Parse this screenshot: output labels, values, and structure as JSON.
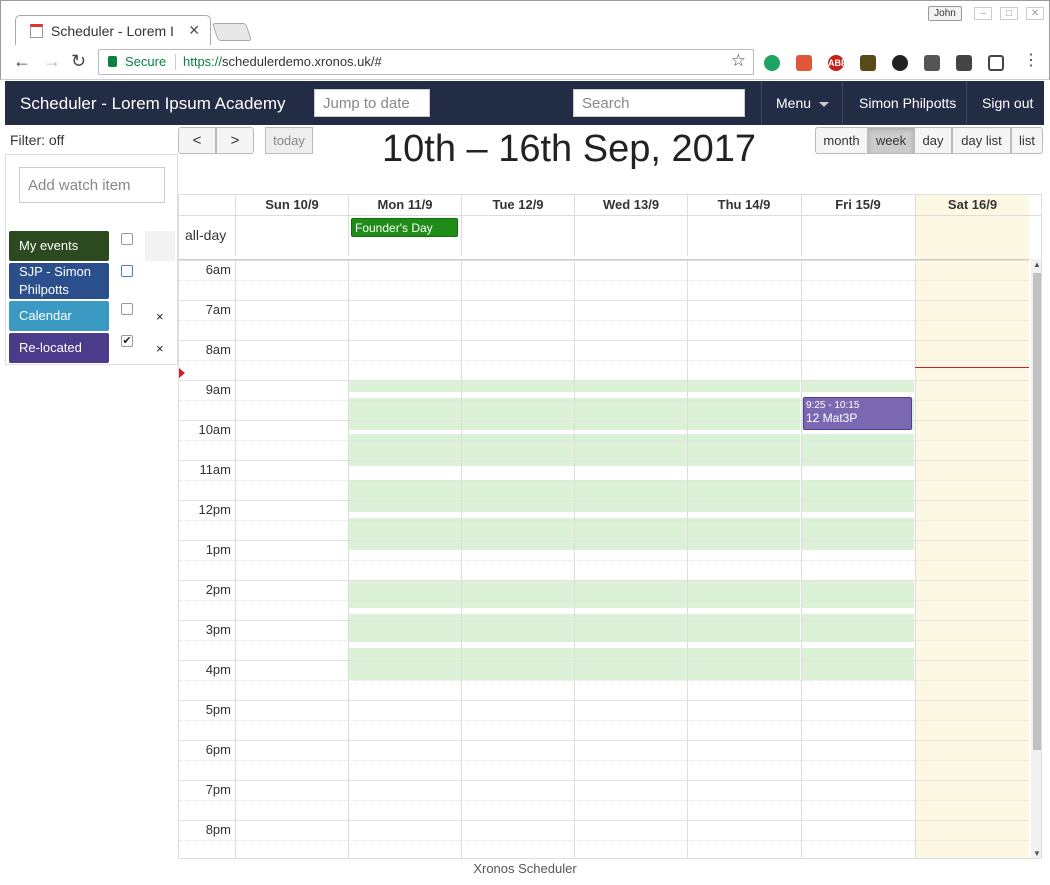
{
  "browser": {
    "tab_title": "Scheduler - Lorem I",
    "user": "John",
    "secure_label": "Secure",
    "url_https": "https://",
    "url_rest": "schedulerdemo.xronos.uk/#",
    "url": "https://schedulerdemo.xronos.uk/#"
  },
  "app": {
    "brand": "Scheduler - Lorem Ipsum Academy",
    "jump_placeholder": "Jump to date",
    "search_placeholder": "Search",
    "menu_label": "Menu",
    "user_name": "Simon Philpotts",
    "signout_label": "Sign out"
  },
  "sidebar": {
    "filter_label": "Filter: off",
    "watch_placeholder": "Add watch item",
    "items": [
      {
        "label": "My events",
        "color": "#2b4a1f",
        "checked": false,
        "removable": false
      },
      {
        "label": "SJP - Simon Philpotts",
        "color": "#2b4f8c",
        "checked": false,
        "removable": false
      },
      {
        "label": "Calendar",
        "color": "#3b9ac4",
        "checked": false,
        "removable": true
      },
      {
        "label": "Re-located",
        "color": "#4a3c8a",
        "checked": true,
        "removable": true
      }
    ],
    "remove_glyph": "×",
    "check_glyph": "✔"
  },
  "toolbar": {
    "prev": "<",
    "next": ">",
    "today": "today",
    "title": "10th – 16th Sep, 2017",
    "views": [
      "month",
      "week",
      "day",
      "day list",
      "list"
    ],
    "active_view": "week"
  },
  "calendar": {
    "days": [
      "Sun 10/9",
      "Mon 11/9",
      "Tue 12/9",
      "Wed 13/9",
      "Thu 14/9",
      "Fri 15/9",
      "Sat 16/9"
    ],
    "today_index": 6,
    "allday_label": "all-day",
    "allday_events": [
      {
        "day": 1,
        "title": "Founder's Day",
        "color": "#1e8c16"
      }
    ],
    "hours": [
      "6am",
      "7am",
      "8am",
      "9am",
      "10am",
      "11am",
      "12pm",
      "1pm",
      "2pm",
      "3pm",
      "4pm",
      "5pm",
      "6pm",
      "7pm",
      "8pm"
    ],
    "events": [
      {
        "day": 5,
        "time": "9:25 - 10:15",
        "title": "12 Mat3P",
        "color": "#7b68b3"
      }
    ],
    "now_time": "8:40",
    "now_color": "#cc2222",
    "band_color": "#dbf2d6",
    "today_color": "#fcf8e3"
  },
  "footer": "Xronos Scheduler"
}
